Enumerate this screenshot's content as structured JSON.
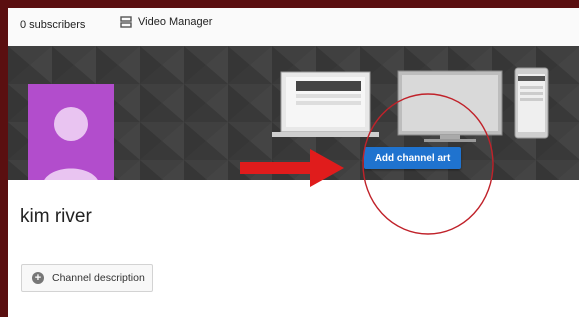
{
  "topbar": {
    "subscribers_label": "0 subscribers",
    "video_manager_label": "Video Manager"
  },
  "channel": {
    "name": "kim river"
  },
  "banner": {
    "add_channel_art_label": "Add channel art",
    "avatar_color": "#b24dcc"
  },
  "about": {
    "channel_description_label": "Channel description"
  },
  "colors": {
    "button_blue": "#1f73cf",
    "arrow_red": "#e01c1c",
    "annotation_circle": "#c0222a",
    "outer_frame": "#5a0f10"
  },
  "icons": {
    "video_manager": "video-manager-icon",
    "plus": "plus-circle-icon"
  }
}
